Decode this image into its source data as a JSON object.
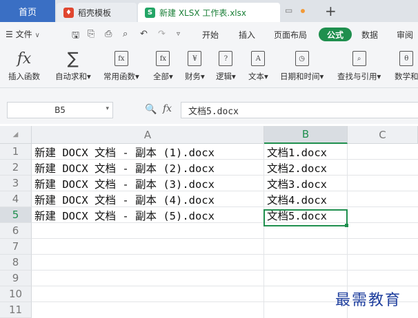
{
  "tabs": {
    "home": "首页",
    "template": "稻壳模板",
    "document": "新建 XLSX 工作表.xlsx",
    "new_tab": "+"
  },
  "menubar": {
    "file": "文件",
    "items": [
      "开始",
      "插入",
      "页面布局",
      "公式",
      "数据",
      "审阅"
    ],
    "active": "公式"
  },
  "ribbon": {
    "items": [
      {
        "icon": "fx-icon",
        "label": "插入函数"
      },
      {
        "icon": "sum-icon",
        "label": "自动求和▾"
      },
      {
        "icon": "common-function-icon",
        "label": "常用函数▾"
      },
      {
        "icon": "all-function-icon",
        "label": "全部▾"
      },
      {
        "icon": "finance-icon",
        "label": "财务▾"
      },
      {
        "icon": "logic-icon",
        "label": "逻辑▾"
      },
      {
        "icon": "text-icon",
        "label": "文本▾"
      },
      {
        "icon": "datetime-icon",
        "label": "日期和时间▾"
      },
      {
        "icon": "lookup-icon",
        "label": "查找与引用▾"
      },
      {
        "icon": "math-icon",
        "label": "数学和"
      }
    ]
  },
  "formula_bar": {
    "cell_ref": "B5",
    "fx": "fx",
    "content": "文档5.docx"
  },
  "sheet": {
    "columns": [
      "A",
      "B",
      "C"
    ],
    "selected_column": "B",
    "selected_row": "5",
    "rows": [
      "1",
      "2",
      "3",
      "4",
      "5",
      "6",
      "7",
      "8",
      "9",
      "10",
      "11"
    ],
    "col_a": [
      "新建 DOCX 文档 - 副本 (1).docx",
      "新建 DOCX 文档 - 副本 (2).docx",
      "新建 DOCX 文档 - 副本 (3).docx",
      "新建 DOCX 文档 - 副本 (4).docx",
      "新建 DOCX 文档 - 副本 (5).docx"
    ],
    "col_b": [
      "文档1.docx",
      "文档2.docx",
      "文档3.docx",
      "文档4.docx",
      "文档5.docx"
    ]
  },
  "watermark": "最需教育",
  "colors": {
    "accent": "#1f8f4e",
    "home_tab": "#3a6fc4",
    "watermark": "#1f3f9e"
  }
}
